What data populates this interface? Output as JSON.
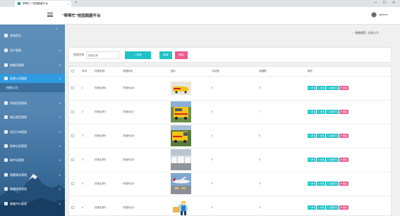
{
  "browser": {
    "tab_title": "帮帮忙一校园跑腿平台",
    "tab_close": "×",
    "new_tab": "+",
    "win_min": "—",
    "win_max": "☐",
    "win_close": "✕"
  },
  "header": {
    "title": "\"帮帮忙\"校园跑腿平台",
    "user_name": "admin ▾"
  },
  "sidebar": {
    "collapse_symbol": "×",
    "items": [
      {
        "label": "系统首页",
        "chevron": ""
      },
      {
        "label": "用户管理",
        "chevron": "∨"
      },
      {
        "label": "跑腿员管理",
        "chevron": "∨"
      },
      {
        "label": "快递公司管理",
        "chevron": "∧"
      },
      {
        "label": "快递信息管理",
        "chevron": "∨"
      },
      {
        "label": "物品类型管理",
        "chevron": "∨"
      },
      {
        "label": "送货订单管理",
        "chevron": "∨"
      },
      {
        "label": "接单记录管理",
        "chevron": "∨"
      },
      {
        "label": "取件码管理",
        "chevron": "∨"
      },
      {
        "label": "跑腿服务管理",
        "chevron": "∨"
      },
      {
        "label": "跑腿接单管理",
        "chevron": "∨"
      },
      {
        "label": "跑腿评价管理",
        "chevron": "∨"
      }
    ],
    "sub_item": "快递公司"
  },
  "breadcrumb": {
    "home": "系统首页",
    "separator": "/",
    "current": "快递公司"
  },
  "search": {
    "label": "快递名称",
    "placeholder": "快递名称",
    "search_button": "查询",
    "search_icon": "⌕",
    "add_button": "新增",
    "delete_button": "删除"
  },
  "table": {
    "headers": [
      "",
      "序号",
      "快递名称",
      "快递地址",
      "图片",
      "评论数",
      "收藏数",
      "操作"
    ],
    "rows": [
      {
        "index": "1",
        "name": "快递名称8",
        "address": "快递地址8",
        "image": "yellow-van",
        "comments": "0",
        "favorites": "8"
      },
      {
        "index": "2",
        "name": "快递名称7",
        "address": "快递地址7",
        "image": "yellow-van-large",
        "comments": "0",
        "favorites": "7"
      },
      {
        "index": "3",
        "name": "快递名称6",
        "address": "快递地址6",
        "image": "yellow-van-side",
        "comments": "0",
        "favorites": "6"
      },
      {
        "index": "4",
        "name": "快递名称5",
        "address": "快递地址5",
        "image": "white-trucks",
        "comments": "0",
        "favorites": "5"
      },
      {
        "index": "5",
        "name": "快递名称4",
        "address": "快递地址4",
        "image": "airplane-cargo",
        "comments": "0",
        "favorites": "4"
      },
      {
        "index": "6",
        "name": "快递名称3",
        "address": "快递地址3",
        "image": "courier-cartoon",
        "comments": "0",
        "favorites": "3"
      }
    ],
    "actions": {
      "detail": "✎ 详情",
      "edit": "✎ 修改",
      "reviews": "✎ 查看评论",
      "delete": "✖ 删除"
    }
  },
  "colors": {
    "accent": "#20c2c7",
    "danger": "#ee5a8e",
    "sidebar_active": "#2f9be0"
  }
}
